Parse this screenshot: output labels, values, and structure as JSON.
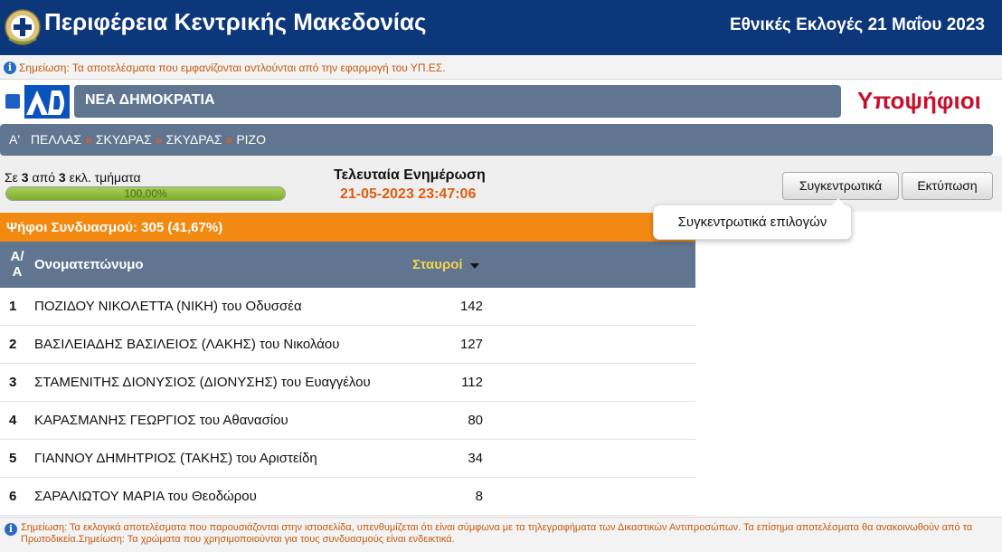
{
  "header": {
    "title": "Περιφέρεια Κεντρικής Μακεδονίας",
    "election": "Εθνικές Εκλογές 21 Μαΐου 2023"
  },
  "notice_top": "Σημείωση: Τα αποτελέσματα που εμφανίζονται αντλούνται από την εφαρμογή του ΥΠ.ΕΣ.",
  "party": {
    "name": "ΝΕΑ ΔΗΜΟΚΡΑΤΙΑ",
    "logo_text": "ΝΔ",
    "color": "#0a52bd"
  },
  "section_title": "Υποψήφιοι",
  "breadcrumb": [
    "Α'",
    "ΠΕΛΛΑΣ",
    "ΣΚΥΔΡΑΣ",
    "ΣΚΥΔΡΑΣ",
    "ΡΙΖΟ"
  ],
  "counting": {
    "prefix": "Σε",
    "counted": "3",
    "of": "από",
    "total": "3",
    "suffix": "εκλ. τμήματα",
    "percent_label": "100,00%",
    "percent_value": 100
  },
  "last_update": {
    "label": "Τελευταία Ενημέρωση",
    "value": "21-05-2023 23:47:06"
  },
  "buttons": {
    "summary": "Συγκεντρωτικά",
    "print": "Εκτύπωση"
  },
  "tooltip": "Συγκεντρωτικά επιλογών",
  "combo_votes": "Ψήφοι Συνδυασμού: 305 (41,67%)",
  "table": {
    "col_aa": "Α/Α",
    "col_name": "Ονοματεπώνυμο",
    "col_votes": "Σταυροί",
    "rows": [
      {
        "aa": "1",
        "name": "ΠΟΖΙΔΟΥ ΝΙΚΟΛΕΤΤΑ (ΝΙΚΗ) του Οδυσσέα",
        "votes": "142"
      },
      {
        "aa": "2",
        "name": "ΒΑΣΙΛΕΙΑΔΗΣ ΒΑΣΙΛΕΙΟΣ (ΛΑΚΗΣ) του Νικολάου",
        "votes": "127"
      },
      {
        "aa": "3",
        "name": "ΣΤΑΜΕΝΙΤΗΣ ΔΙΟΝΥΣΙΟΣ (ΔΙΟΝΥΣΗΣ) του Ευαγγέλου",
        "votes": "112"
      },
      {
        "aa": "4",
        "name": "ΚΑΡΑΣΜΑΝΗΣ ΓΕΩΡΓΙΟΣ του Αθανασίου",
        "votes": "80"
      },
      {
        "aa": "5",
        "name": "ΓΙΑΝΝΟΥ ΔΗΜΗΤΡΙΟΣ (ΤΑΚΗΣ) του Αριστείδη",
        "votes": "34"
      },
      {
        "aa": "6",
        "name": "ΣΑΡΑΛΙΩΤΟΥ ΜΑΡΙΑ του Θεοδώρου",
        "votes": "8"
      }
    ]
  },
  "notice_bottom": "Σημείωση: Τα εκλογικά αποτελέσματα που παρουσιάζονται στην ιστοσελίδα, υπενθυμίζεται ότι είναι σύμφωνα με τα τηλεγραφήματα των Δικαστικών Αντιπροσώπων. Τα επίσημα αποτελέσματα θα ανακοινωθούν από τα Πρωτοδικεία.Σημείωση: Τα χρώματα που χρησιμοποιούνται για τους συνδυασμούς είναι ενδεικτικά.",
  "colors": {
    "header_bg": "#0c377a",
    "bar_bg": "#5f7590",
    "accent_orange": "#f28a12",
    "title_red": "#c8102e",
    "time_orange": "#e25b10"
  }
}
